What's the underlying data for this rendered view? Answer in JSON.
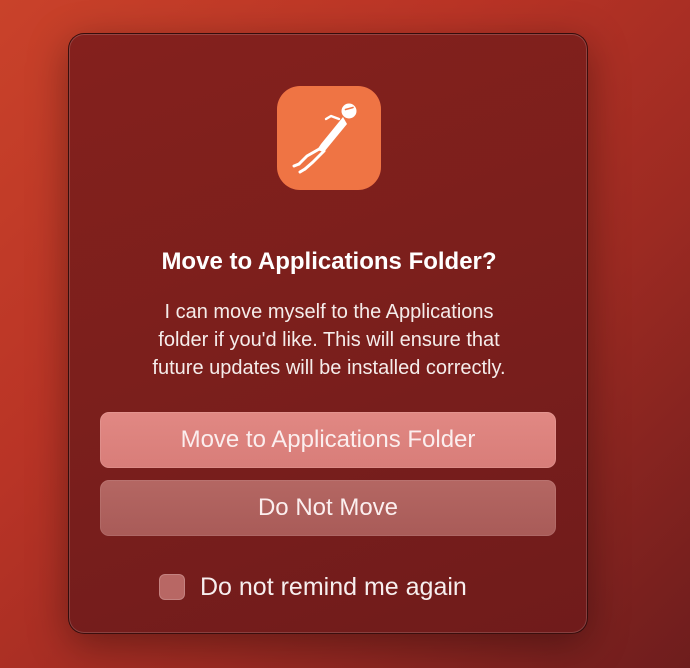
{
  "dialog": {
    "app_icon": "postman-rocketman-icon",
    "title": "Move to Applications Folder?",
    "message_lines": [
      "I can move myself to the Applications",
      "folder if you'd like. This will ensure that",
      "future updates will be installed correctly."
    ],
    "primary_button": "Move to Applications Folder",
    "secondary_button": "Do Not Move",
    "checkbox": {
      "label": "Do not remind me again",
      "checked": false
    }
  },
  "colors": {
    "app_icon_bg": "#ef7444",
    "dialog_bg": "#7b1f1c",
    "primary_button_bg": "#dd8480",
    "secondary_button_bg": "#ae605d"
  }
}
